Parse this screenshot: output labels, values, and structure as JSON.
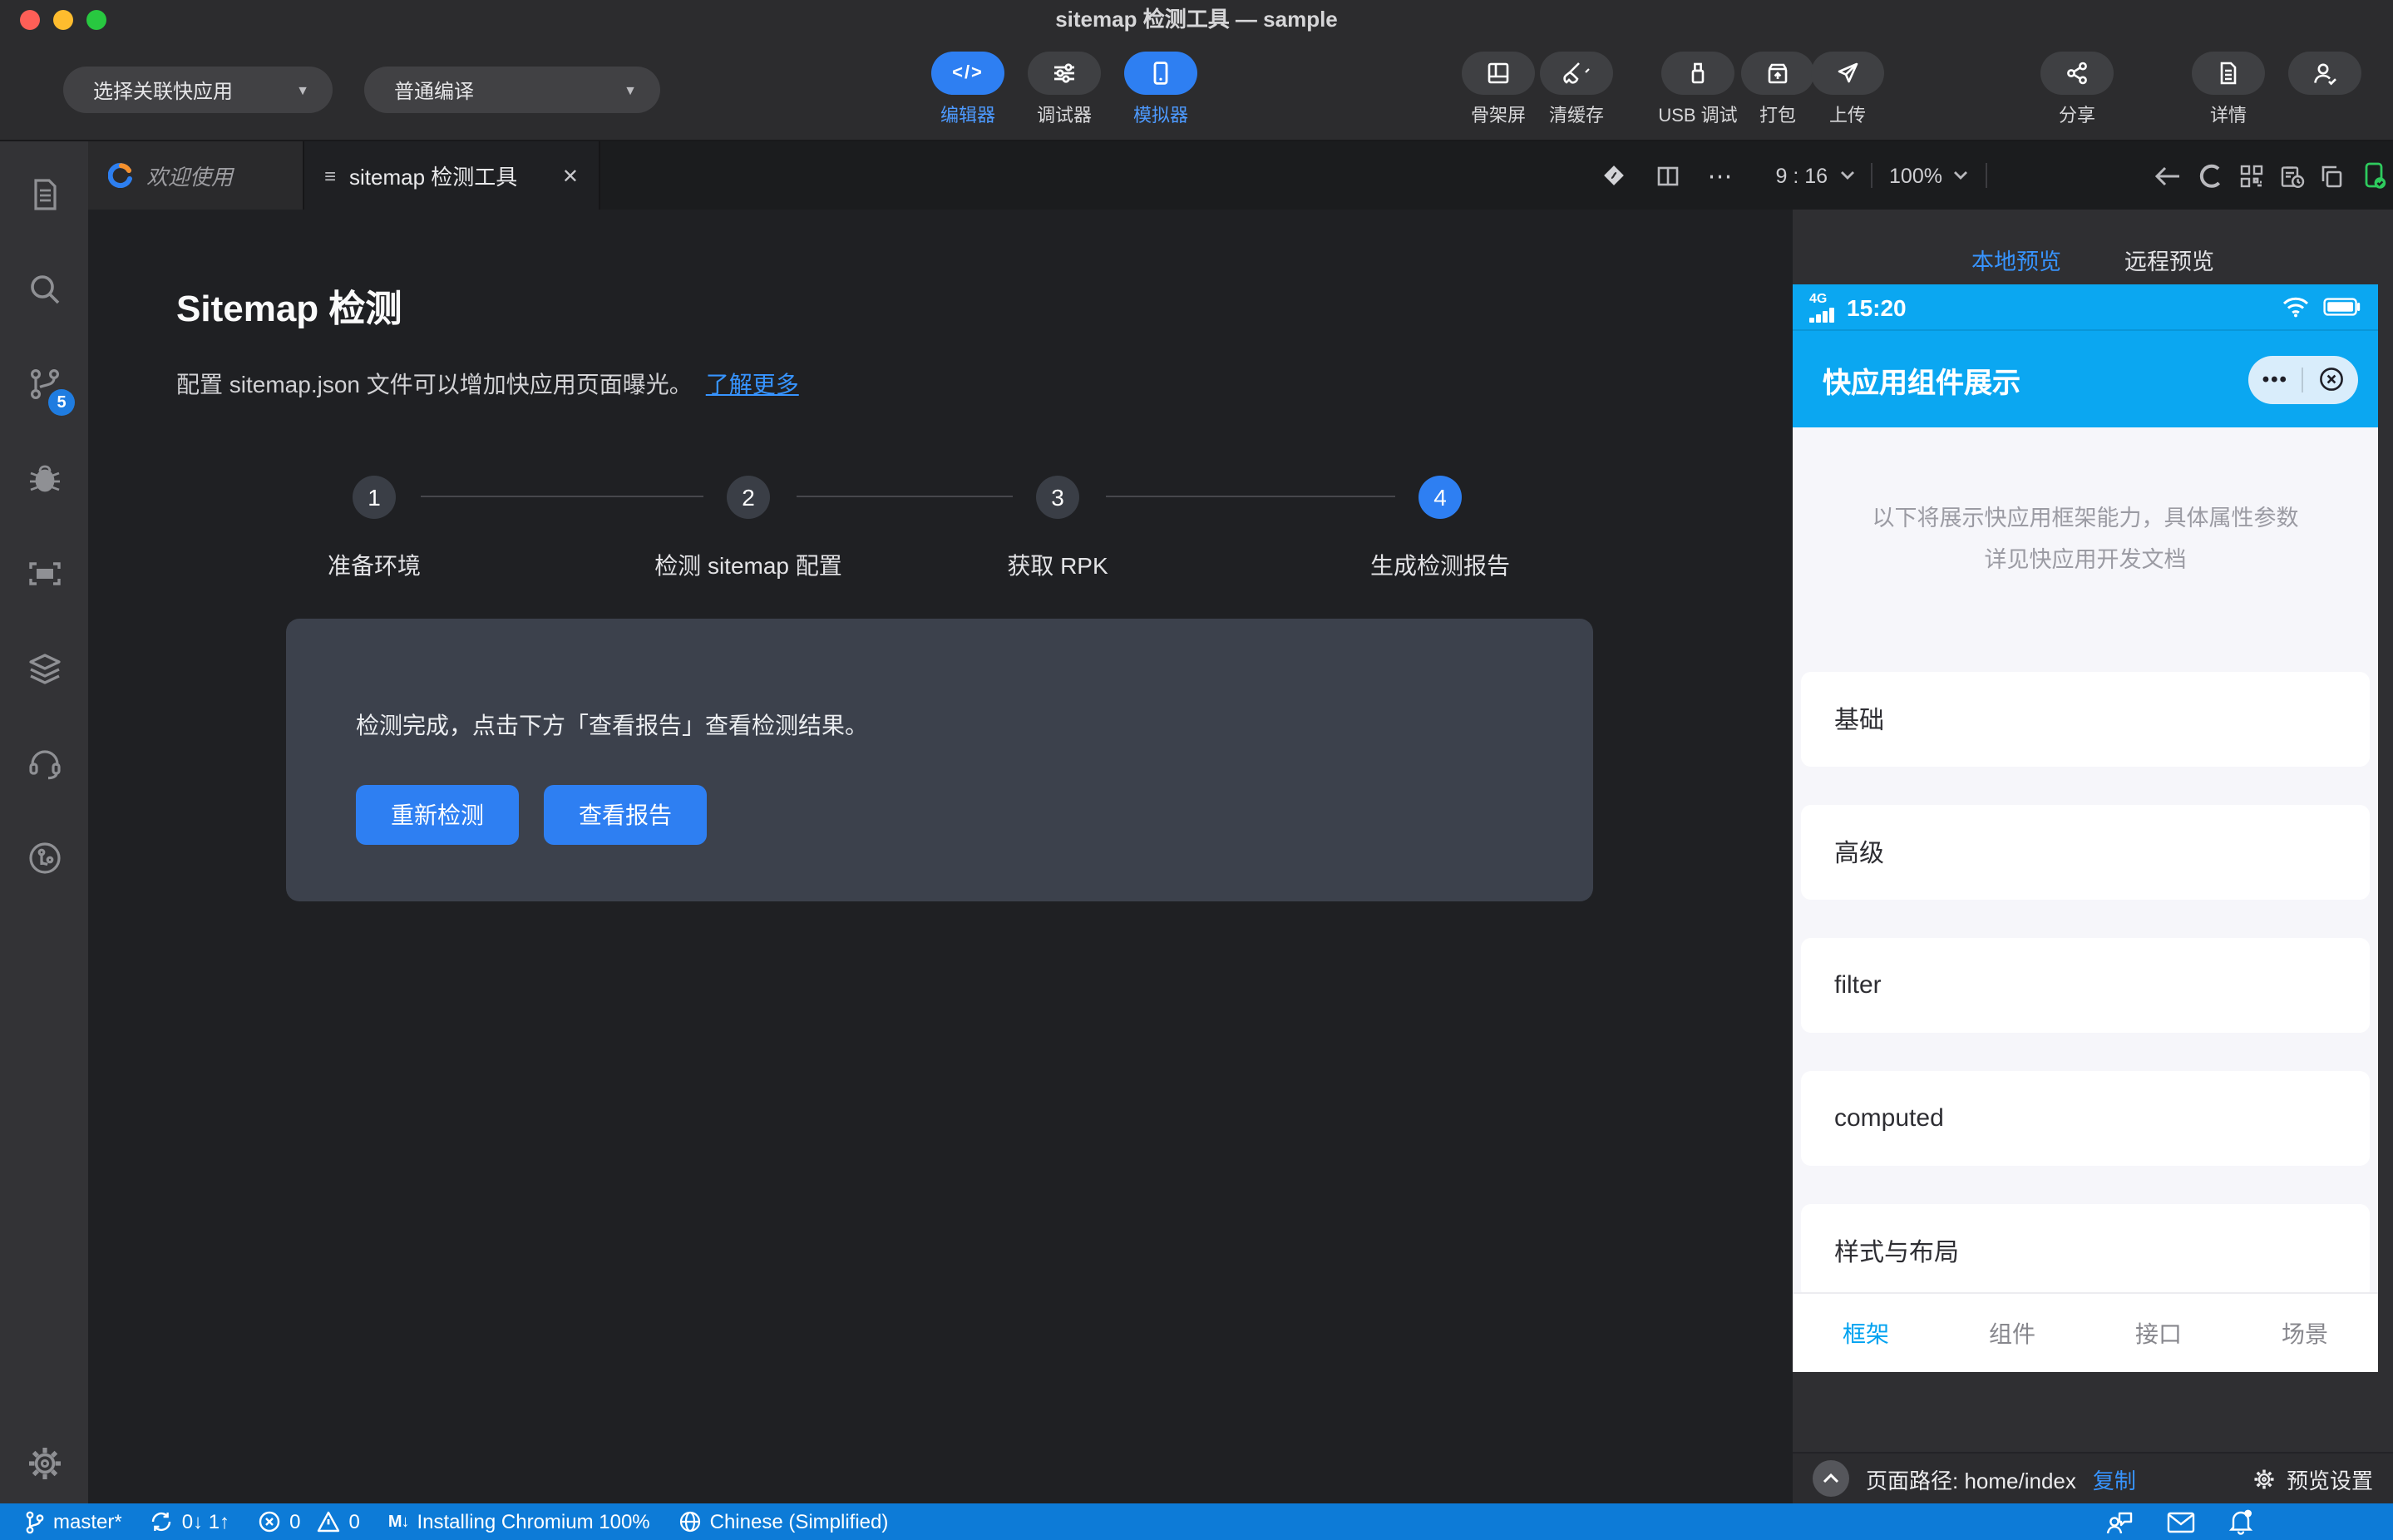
{
  "colors": {
    "accent": "#2e7ff2",
    "link": "#3794ff",
    "phoneBlue": "#0ba7f1",
    "phoneCyan": "#00a2f0",
    "statusbar": "#0d7bd7",
    "badge": "#1f7ce0"
  },
  "window": {
    "title": "sitemap 检测工具 — sample"
  },
  "toolbar": {
    "app_select": "选择关联快应用",
    "compile_mode": "普通编译",
    "center_buttons": [
      {
        "label": "编辑器",
        "active": true
      },
      {
        "label": "调试器",
        "active": false
      },
      {
        "label": "模拟器",
        "active": true
      }
    ],
    "right_buttons": [
      {
        "label": "骨架屏"
      },
      {
        "label": "清缓存"
      },
      {
        "label": "USB 调试"
      },
      {
        "label": "打包"
      },
      {
        "label": "上传"
      },
      {
        "label": "分享"
      },
      {
        "label": "详情"
      }
    ]
  },
  "sidebar": {
    "scm_badge": "5"
  },
  "tabs": {
    "welcome": "欢迎使用",
    "active": "sitemap 检测工具"
  },
  "strip_controls": {
    "ratio": "9 : 16",
    "zoom": "100%"
  },
  "main": {
    "title": "Sitemap 检测",
    "description": "配置 sitemap.json 文件可以增加快应用页面曝光。",
    "learn_more": "了解更多",
    "steps": [
      {
        "num": "1",
        "label": "准备环境"
      },
      {
        "num": "2",
        "label": "检测 sitemap 配置"
      },
      {
        "num": "3",
        "label": "获取 RPK"
      },
      {
        "num": "4",
        "label": "生成检测报告"
      }
    ],
    "result": {
      "message": "检测完成，点击下方「查看报告」查看检测结果。",
      "recheck": "重新检测",
      "view_report": "查看报告"
    }
  },
  "preview": {
    "tabs": {
      "local": "本地预览",
      "remote": "远程预览"
    },
    "phone": {
      "network": "4G",
      "time": "15:20",
      "app_title": "快应用组件展示",
      "intro_line1": "以下将展示快应用框架能力，具体属性参数",
      "intro_line2": "详见快应用开发文档",
      "list": [
        "基础",
        "高级",
        "filter",
        "computed",
        "样式与布局"
      ],
      "tabs": [
        {
          "label": "框架",
          "active": true
        },
        {
          "label": "组件",
          "active": false
        },
        {
          "label": "接口",
          "active": false
        },
        {
          "label": "场景",
          "active": false
        }
      ]
    },
    "pathbar": {
      "label": "页面路径: home/index",
      "copy": "复制",
      "settings": "预览设置"
    }
  },
  "statusbar": {
    "branch": "master*",
    "sync": "0↓ 1↑",
    "errors": "0",
    "warnings": "0",
    "task": "Installing Chromium 100%",
    "language": "Chinese (Simplified)"
  },
  "icons": {
    "code": "</>",
    "dots": "⋯",
    "chevron_down": "⌄",
    "cap_dots": "•••",
    "m_down": "M↓",
    "close": "✕",
    "list": "≡"
  }
}
